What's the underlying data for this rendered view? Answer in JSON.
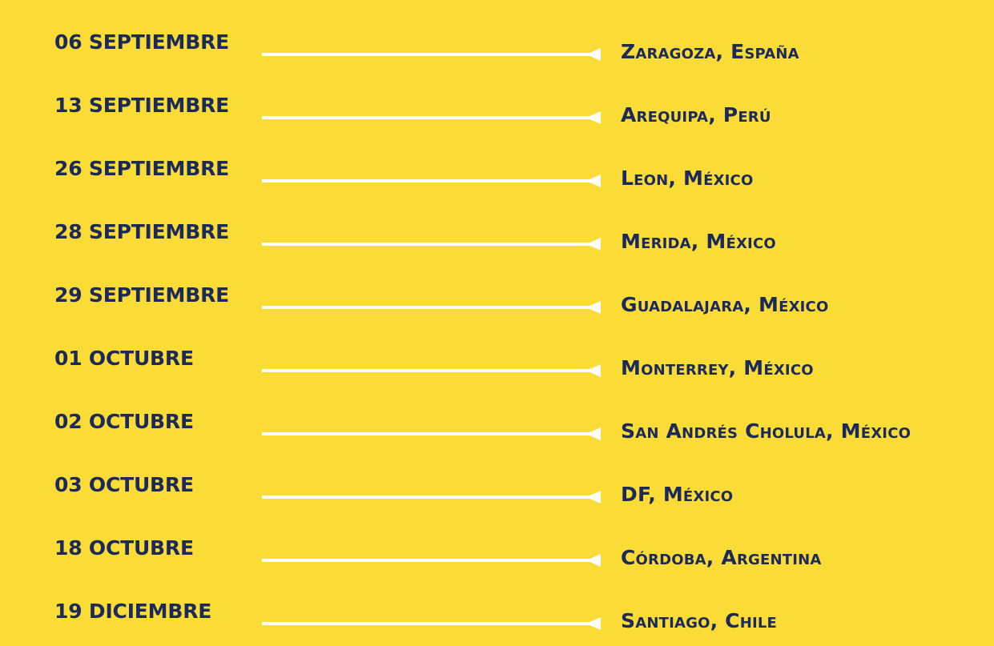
{
  "schedule": [
    {
      "date": "06 SEPTIEMBRE",
      "place": "Zaragoza, España"
    },
    {
      "date": "13 SEPTIEMBRE",
      "place": "Arequipa, Perú"
    },
    {
      "date": "26 SEPTIEMBRE",
      "place": "Leon, México"
    },
    {
      "date": "28 SEPTIEMBRE",
      "place": "Merida, México"
    },
    {
      "date": "29 SEPTIEMBRE",
      "place": "Guadalajara, México"
    },
    {
      "date": "01 OCTUBRE",
      "place": "Monterrey, México"
    },
    {
      "date": "02 OCTUBRE",
      "place": "San Andrés Cholula, México"
    },
    {
      "date": "03 OCTUBRE",
      "place": "DF, México"
    },
    {
      "date": "18 OCTUBRE",
      "place": "Córdoba, Argentina"
    },
    {
      "date": "19 DICIEMBRE",
      "place": "Santiago, Chile"
    }
  ],
  "colors": {
    "background": "#fbdb35",
    "text": "#1b2a5a",
    "connector": "#ffffff"
  }
}
